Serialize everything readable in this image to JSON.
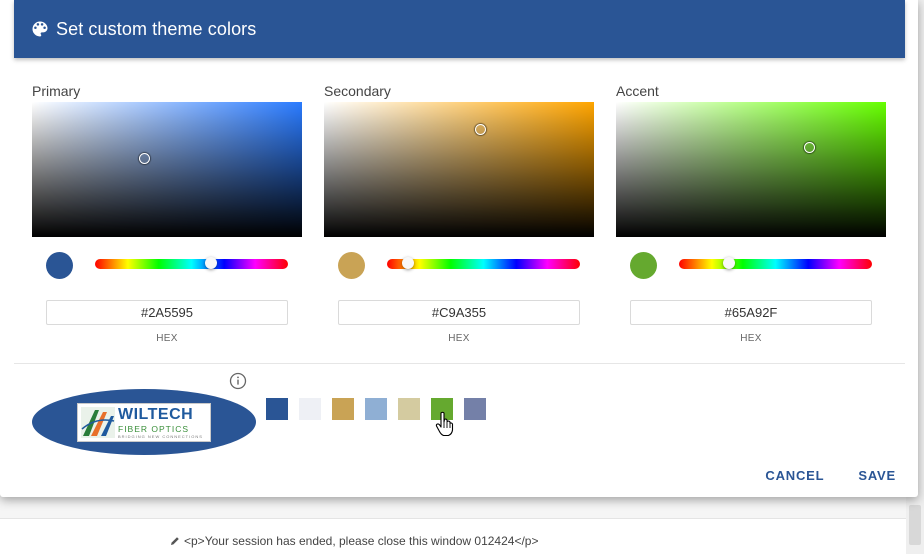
{
  "dialog": {
    "title": "Set custom theme colors",
    "cancel_label": "CANCEL",
    "save_label": "SAVE"
  },
  "pickers": [
    {
      "label": "Primary",
      "hex": "#2A5595",
      "hex_caption": "HEX",
      "hue_color": "#2a7bff",
      "hue_fraction": 0.6,
      "saturation": 0.42,
      "value": 0.58
    },
    {
      "label": "Secondary",
      "hex": "#C9A355",
      "hex_caption": "HEX",
      "hue_color": "#ffa500",
      "hue_fraction": 0.11,
      "saturation": 0.58,
      "value": 0.79
    },
    {
      "label": "Accent",
      "hex": "#65A92F",
      "hex_caption": "HEX",
      "hue_color": "#66ff00",
      "hue_fraction": 0.26,
      "saturation": 0.72,
      "value": 0.66
    }
  ],
  "logo": {
    "name": "WILTECH",
    "subtitle": "FIBER OPTICS",
    "tagline": "BRIDGING NEW CONNECTIONS",
    "ellipse_color": "#2a5595"
  },
  "preset_colors": [
    "#2a5595",
    "#eef0f5",
    "#c9a355",
    "#8fafd4",
    "#d4cba0",
    "#65a92f",
    "#7480a8"
  ],
  "session_message": "<p>Your session has ended, please close this window 012424</p>",
  "icons": [
    "palette-icon",
    "info-icon",
    "pencil-icon",
    "hand-pointer-icon"
  ]
}
